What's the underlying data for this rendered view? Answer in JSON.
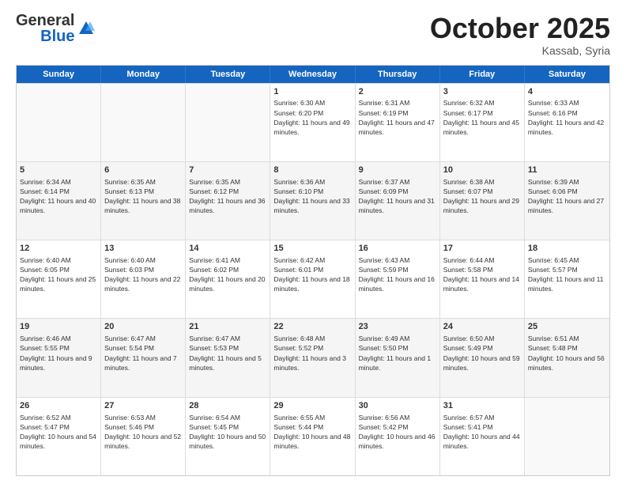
{
  "header": {
    "logo_general": "General",
    "logo_blue": "Blue",
    "month_title": "October 2025",
    "subtitle": "Kassab, Syria"
  },
  "days": [
    "Sunday",
    "Monday",
    "Tuesday",
    "Wednesday",
    "Thursday",
    "Friday",
    "Saturday"
  ],
  "rows": [
    [
      {
        "day": "",
        "text": ""
      },
      {
        "day": "",
        "text": ""
      },
      {
        "day": "",
        "text": ""
      },
      {
        "day": "1",
        "text": "Sunrise: 6:30 AM\nSunset: 6:20 PM\nDaylight: 11 hours and 49 minutes."
      },
      {
        "day": "2",
        "text": "Sunrise: 6:31 AM\nSunset: 6:19 PM\nDaylight: 11 hours and 47 minutes."
      },
      {
        "day": "3",
        "text": "Sunrise: 6:32 AM\nSunset: 6:17 PM\nDaylight: 11 hours and 45 minutes."
      },
      {
        "day": "4",
        "text": "Sunrise: 6:33 AM\nSunset: 6:16 PM\nDaylight: 11 hours and 42 minutes."
      }
    ],
    [
      {
        "day": "5",
        "text": "Sunrise: 6:34 AM\nSunset: 6:14 PM\nDaylight: 11 hours and 40 minutes."
      },
      {
        "day": "6",
        "text": "Sunrise: 6:35 AM\nSunset: 6:13 PM\nDaylight: 11 hours and 38 minutes."
      },
      {
        "day": "7",
        "text": "Sunrise: 6:35 AM\nSunset: 6:12 PM\nDaylight: 11 hours and 36 minutes."
      },
      {
        "day": "8",
        "text": "Sunrise: 6:36 AM\nSunset: 6:10 PM\nDaylight: 11 hours and 33 minutes."
      },
      {
        "day": "9",
        "text": "Sunrise: 6:37 AM\nSunset: 6:09 PM\nDaylight: 11 hours and 31 minutes."
      },
      {
        "day": "10",
        "text": "Sunrise: 6:38 AM\nSunset: 6:07 PM\nDaylight: 11 hours and 29 minutes."
      },
      {
        "day": "11",
        "text": "Sunrise: 6:39 AM\nSunset: 6:06 PM\nDaylight: 11 hours and 27 minutes."
      }
    ],
    [
      {
        "day": "12",
        "text": "Sunrise: 6:40 AM\nSunset: 6:05 PM\nDaylight: 11 hours and 25 minutes."
      },
      {
        "day": "13",
        "text": "Sunrise: 6:40 AM\nSunset: 6:03 PM\nDaylight: 11 hours and 22 minutes."
      },
      {
        "day": "14",
        "text": "Sunrise: 6:41 AM\nSunset: 6:02 PM\nDaylight: 11 hours and 20 minutes."
      },
      {
        "day": "15",
        "text": "Sunrise: 6:42 AM\nSunset: 6:01 PM\nDaylight: 11 hours and 18 minutes."
      },
      {
        "day": "16",
        "text": "Sunrise: 6:43 AM\nSunset: 5:59 PM\nDaylight: 11 hours and 16 minutes."
      },
      {
        "day": "17",
        "text": "Sunrise: 6:44 AM\nSunset: 5:58 PM\nDaylight: 11 hours and 14 minutes."
      },
      {
        "day": "18",
        "text": "Sunrise: 6:45 AM\nSunset: 5:57 PM\nDaylight: 11 hours and 11 minutes."
      }
    ],
    [
      {
        "day": "19",
        "text": "Sunrise: 6:46 AM\nSunset: 5:55 PM\nDaylight: 11 hours and 9 minutes."
      },
      {
        "day": "20",
        "text": "Sunrise: 6:47 AM\nSunset: 5:54 PM\nDaylight: 11 hours and 7 minutes."
      },
      {
        "day": "21",
        "text": "Sunrise: 6:47 AM\nSunset: 5:53 PM\nDaylight: 11 hours and 5 minutes."
      },
      {
        "day": "22",
        "text": "Sunrise: 6:48 AM\nSunset: 5:52 PM\nDaylight: 11 hours and 3 minutes."
      },
      {
        "day": "23",
        "text": "Sunrise: 6:49 AM\nSunset: 5:50 PM\nDaylight: 11 hours and 1 minute."
      },
      {
        "day": "24",
        "text": "Sunrise: 6:50 AM\nSunset: 5:49 PM\nDaylight: 10 hours and 59 minutes."
      },
      {
        "day": "25",
        "text": "Sunrise: 6:51 AM\nSunset: 5:48 PM\nDaylight: 10 hours and 56 minutes."
      }
    ],
    [
      {
        "day": "26",
        "text": "Sunrise: 6:52 AM\nSunset: 5:47 PM\nDaylight: 10 hours and 54 minutes."
      },
      {
        "day": "27",
        "text": "Sunrise: 6:53 AM\nSunset: 5:46 PM\nDaylight: 10 hours and 52 minutes."
      },
      {
        "day": "28",
        "text": "Sunrise: 6:54 AM\nSunset: 5:45 PM\nDaylight: 10 hours and 50 minutes."
      },
      {
        "day": "29",
        "text": "Sunrise: 6:55 AM\nSunset: 5:44 PM\nDaylight: 10 hours and 48 minutes."
      },
      {
        "day": "30",
        "text": "Sunrise: 6:56 AM\nSunset: 5:42 PM\nDaylight: 10 hours and 46 minutes."
      },
      {
        "day": "31",
        "text": "Sunrise: 6:57 AM\nSunset: 5:41 PM\nDaylight: 10 hours and 44 minutes."
      },
      {
        "day": "",
        "text": ""
      }
    ]
  ]
}
